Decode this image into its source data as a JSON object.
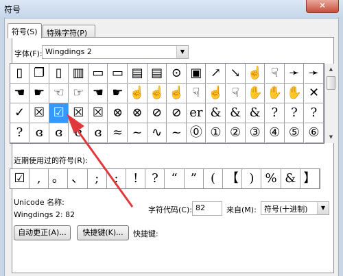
{
  "window": {
    "title": "符号",
    "close_glyph": "✕"
  },
  "tabs": [
    {
      "label": "符号(S)"
    },
    {
      "label": "特殊字符(P)"
    }
  ],
  "font": {
    "label": "字体(F):",
    "value": "Wingdings 2"
  },
  "symbol_grid": {
    "rows": [
      [
        "▯",
        "❐",
        "▯",
        "▥",
        "▭",
        "▭",
        "▤",
        "▤",
        "⊙",
        "▣",
        "↗",
        "↘",
        "☝",
        "☟",
        "➛",
        "➛"
      ],
      [
        "☚",
        "☛",
        "☜",
        "☞",
        "☚",
        "☛",
        "☝",
        "☝",
        "☝",
        "☟",
        "☝",
        "☟",
        "✋",
        "✋",
        "✋",
        "✕"
      ],
      [
        "✓",
        "☒",
        "☑",
        "☒",
        "☒",
        "⊗",
        "⊗",
        "⊘",
        "⊘",
        "er",
        "&",
        "&",
        "&",
        "?",
        "?",
        "?"
      ],
      [
        "?",
        "ɞ",
        "ɞ",
        "ɞ",
        "ɞ",
        "≈",
        "~",
        "∿",
        "~",
        "⓪",
        "①",
        "②",
        "③",
        "④",
        "⑤",
        "⑥"
      ]
    ],
    "selected": "☑"
  },
  "recent": {
    "label": "近期使用过的符号(R):",
    "symbols": [
      "☑",
      ",",
      "。",
      "、",
      ";",
      ":",
      "!",
      "?",
      "“",
      "”",
      "(",
      "【",
      ")",
      "%",
      "&",
      "】"
    ]
  },
  "unicode_name": {
    "label": "Unicode 名称:",
    "value": "Wingdings 2: 82"
  },
  "char_code": {
    "label": "字符代码(C):",
    "value": "82"
  },
  "from": {
    "label": "来自(M):",
    "value": "符号(十进制)"
  },
  "buttons": {
    "autocorrect": "自动更正(A)...",
    "shortcut_key": "快捷键(K)...",
    "shortcut_label": "快捷键:"
  }
}
